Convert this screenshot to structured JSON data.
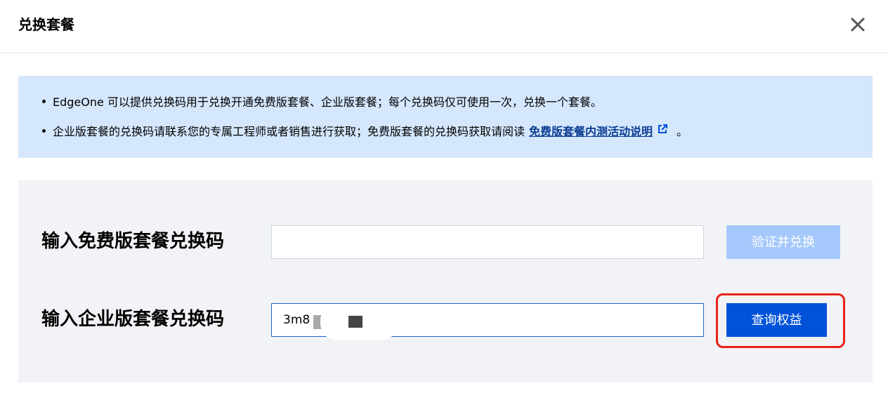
{
  "dialog": {
    "title": "兑换套餐",
    "close_icon": "close-icon"
  },
  "notice": {
    "line1": "EdgeOne 可以提供兑换码用于兑换开通免费版套餐、企业版套餐；每个兑换码仅可使用一次，兑换一个套餐。",
    "line2_prefix": "企业版套餐的兑换码请联系您的专属工程师或者销售进行获取；免费版套餐的兑换码获取请阅读",
    "line2_link": "免费版套餐内测活动说明",
    "line2_suffix": "。",
    "link_icon": "external-link-icon",
    "background": "#d5e7fd",
    "link_color": "#0a3d91"
  },
  "free_redeem": {
    "label": "输入免费版套餐兑换码",
    "value": "",
    "button_label": "验证并兑换",
    "button_color": "#a4c8fb"
  },
  "enterprise_redeem": {
    "label": "输入企业版套餐兑换码",
    "value": "3m8",
    "button_label": "查询权益",
    "button_color": "#0052d9"
  },
  "highlight_color": "#e8221b"
}
